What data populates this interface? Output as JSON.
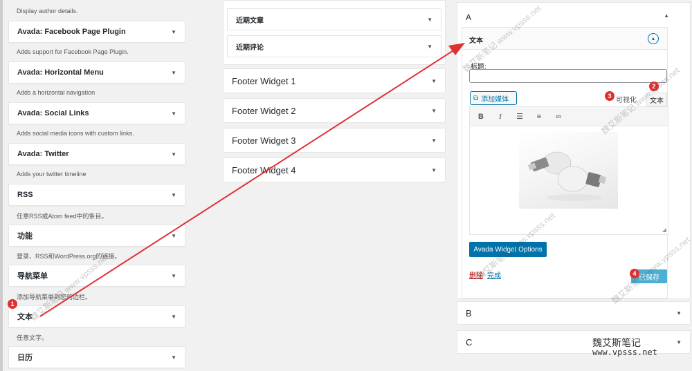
{
  "available_widgets": [
    {
      "desc": "Display author details."
    },
    {
      "label": "Avada: Facebook Page Plugin",
      "desc": "Adds support for Facebook Page Plugin."
    },
    {
      "label": "Avada: Horizontal Menu",
      "desc": "Adds a horizontal navigation"
    },
    {
      "label": "Avada: Social Links",
      "desc": "Adds social media icons with custom links."
    },
    {
      "label": "Avada: Twitter",
      "desc": "Adds your twitter timeline"
    },
    {
      "label": "RSS",
      "desc": "任意RSS或Atom feed中的条目。"
    },
    {
      "label": "功能",
      "desc": "登录、RSS和WordPress.org的链接。"
    },
    {
      "label": "导航菜单",
      "desc": "添加导航菜单到您的边栏。"
    },
    {
      "label": "文本",
      "desc": "任意文字。"
    },
    {
      "label": "日历"
    }
  ],
  "middle_widgets": [
    "近期文章",
    "近期评论"
  ],
  "footer_sidebars": [
    "Footer Widget 1",
    "Footer Widget 2",
    "Footer Widget 3",
    "Footer Widget 4"
  ],
  "right_sidebar": {
    "title": "A",
    "widget": {
      "title": "文本",
      "title_label": "标题:",
      "add_media": "添加媒体",
      "tab_visual": "可视化",
      "tab_text": "文本",
      "toolbar_icons": [
        "bold-icon",
        "italic-icon",
        "bulleted-list-icon",
        "numbered-list-icon",
        "link-icon"
      ],
      "bold": "B",
      "italic": "I",
      "avada_options": "Avada Widget Options",
      "delete": "删除",
      "done": "完成",
      "saved": "已保存"
    },
    "other_sidebars": [
      "B",
      "C"
    ]
  },
  "badges": [
    "1",
    "2",
    "3",
    "4"
  ],
  "watermark": {
    "text": "魏艾斯笔记",
    "url": "www.vpsss.net"
  },
  "colors": {
    "accent": "#0073aa",
    "badge": "#e03131",
    "arrow": "#e03131"
  }
}
